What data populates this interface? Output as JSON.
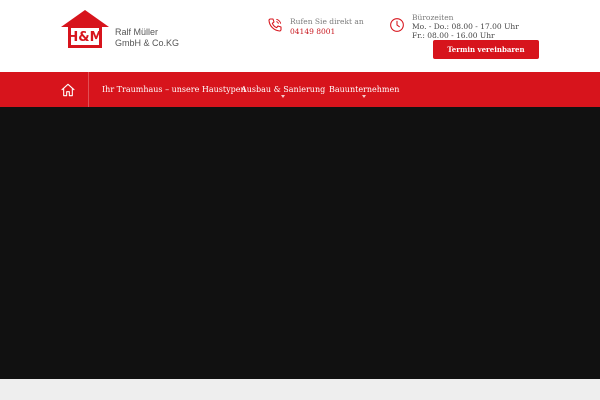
{
  "header": {
    "logo_icon": "house-logo-icon",
    "logo_text": "H&M",
    "company_line1": "Ralf Müller",
    "company_line2": "GmbH & Co.KG",
    "phone": {
      "icon": "phone-icon",
      "label": "Rufen Sie direkt an",
      "number": "04149 8001"
    },
    "hours": {
      "icon": "clock-icon",
      "label": "Bürozeiten",
      "line1": "Mo. - Do.: 08.00 - 17.00 Uhr",
      "line2": "Fr.: 08.00 - 16.00 Uhr"
    },
    "cta_label": "Termin vereinbaren"
  },
  "nav": {
    "home_icon": "home-icon",
    "items": [
      {
        "label": "Ihr Traumhaus – unsere Haustypen",
        "has_dropdown": false
      },
      {
        "label": "Ausbau & Sanierung",
        "has_dropdown": true
      },
      {
        "label": "Bauunternehmen",
        "has_dropdown": true
      }
    ]
  },
  "colors": {
    "brand_red": "#d7141c",
    "hero_bg": "#111111",
    "footer_bg": "#eeeeee"
  }
}
